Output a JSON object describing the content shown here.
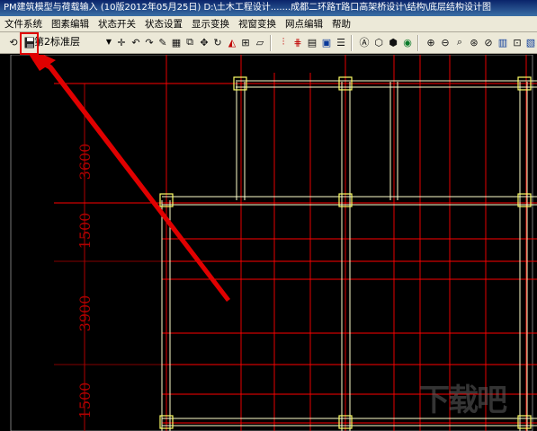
{
  "window": {
    "title": "PM建筑模型与荷载输入 (10版2012年05月25日)  D:\\土木工程设计.......成都二环路T路口高架桥设计\\结构\\底层结构设计图"
  },
  "menu": {
    "items": [
      "文件系统",
      "图素编辑",
      "状态开关",
      "状态设置",
      "显示变换",
      "视窗变换",
      "网点编辑",
      "帮助"
    ]
  },
  "toolbar": {
    "floor_select_value": "第2标准层",
    "buttons": [
      "undo-icon",
      "save-icon",
      "crosshair-icon",
      "undo-arrow-icon",
      "redo-arrow-icon",
      "pencil-icon",
      "grid-icon",
      "copy-icon",
      "move-icon",
      "rotate-icon",
      "mirror-icon",
      "offset-icon",
      "axis-icon",
      "grid-axis-icon",
      "layer-icon",
      "properties-icon",
      "view-3d-icon",
      "cube-icon",
      "cube-solid-icon",
      "eye-icon",
      "zoom-in-icon",
      "zoom-out-icon",
      "zoom-window-icon",
      "zoom-all-icon",
      "print-icon",
      "render-icon"
    ]
  },
  "drawing": {
    "dimensions": [
      "3600",
      "1500",
      "3900",
      "1500"
    ]
  },
  "watermark": "下载吧",
  "colors": {
    "background": "#000000",
    "gridline": "#ff0000",
    "beam": "#ffffcc",
    "dimension_text": "#b00000",
    "annotation_arrow": "#e00000"
  }
}
